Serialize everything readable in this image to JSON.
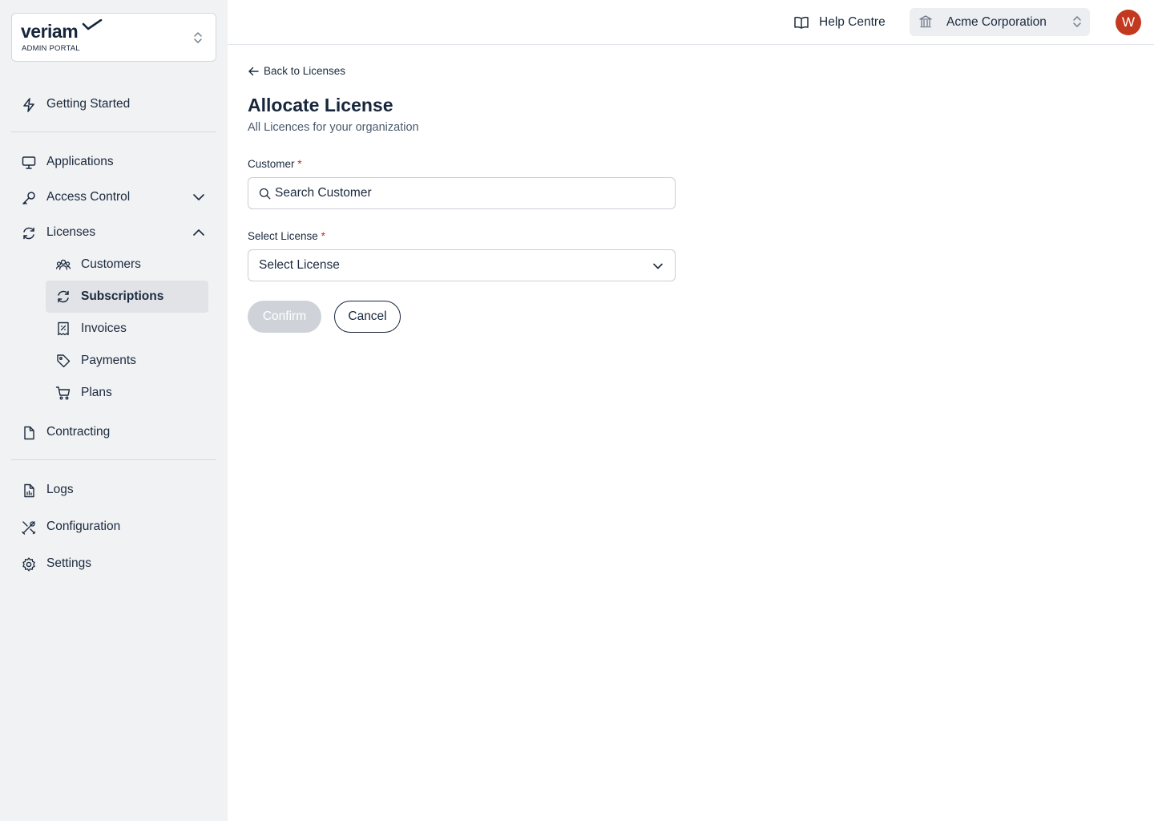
{
  "brand": {
    "name": "veriam",
    "subtitle": "ADMIN PORTAL"
  },
  "sidebar": {
    "items": [
      {
        "label": "Getting Started",
        "icon": "lightning-icon"
      },
      {
        "label": "Applications",
        "icon": "monitor-icon"
      },
      {
        "label": "Access Control",
        "icon": "key-icon",
        "expanded": false
      },
      {
        "label": "Licenses",
        "icon": "refresh-icon",
        "expanded": true
      },
      {
        "label": "Contracting",
        "icon": "document-icon"
      },
      {
        "label": "Logs",
        "icon": "log-file-icon"
      },
      {
        "label": "Configuration",
        "icon": "tools-icon"
      },
      {
        "label": "Settings",
        "icon": "gear-icon"
      }
    ],
    "license_subitems": [
      {
        "label": "Customers",
        "icon": "users-icon"
      },
      {
        "label": "Subscriptions",
        "icon": "refresh-icon",
        "active": true
      },
      {
        "label": "Invoices",
        "icon": "receipt-icon"
      },
      {
        "label": "Payments",
        "icon": "tag-icon"
      },
      {
        "label": "Plans",
        "icon": "cart-icon"
      }
    ]
  },
  "topbar": {
    "help_label": "Help Centre",
    "org_name": "Acme Corporation",
    "avatar_initial": "W"
  },
  "main": {
    "back_label": "Back to Licenses",
    "title": "Allocate License",
    "subtitle": "All Licences for your organization",
    "customer": {
      "label": "Customer",
      "required_mark": "*",
      "placeholder": "Search Customer",
      "value": ""
    },
    "license": {
      "label": "Select License",
      "required_mark": "*",
      "selected": "Select License"
    },
    "confirm_label": "Confirm",
    "cancel_label": "Cancel"
  },
  "colors": {
    "sidebar_bg": "#f1f2f4",
    "active_item_bg": "#e1e3e7",
    "text_primary": "#1b2a3d",
    "avatar_bg": "#c2391f",
    "required": "#c6281e",
    "button_disabled": "#cfd3d9"
  }
}
